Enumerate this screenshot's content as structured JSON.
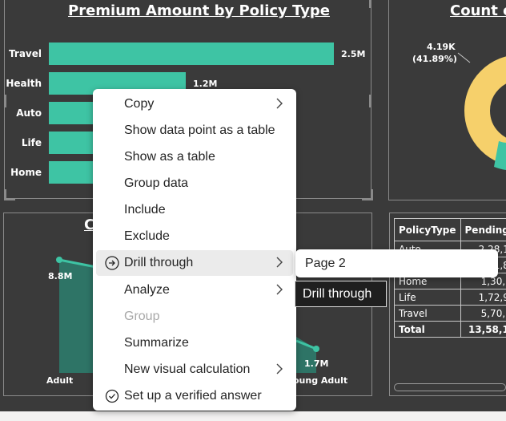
{
  "bar_visual": {
    "title": "Premium Amount by Policy Type",
    "chart_data": {
      "type": "bar",
      "orientation": "horizontal",
      "categories": [
        "Travel",
        "Health",
        "Auto",
        "Life",
        "Home"
      ],
      "values": [
        2.5,
        1.2,
        0.95,
        0.85,
        0.75
      ],
      "value_labels": [
        "2.5M",
        "1.2M",
        "",
        "",
        ""
      ],
      "unit": "M",
      "color": "#3ec4a4"
    }
  },
  "donut_visual": {
    "title": "Count o",
    "label_value": "4.19K",
    "label_pct": "(41.89%)",
    "colors": [
      "#f6d06b",
      "#3ec4a4"
    ]
  },
  "area_visual": {
    "title": "C",
    "chart_data": {
      "type": "area",
      "categories": [
        "Adult",
        "Young Adult"
      ],
      "labels": [
        "8.8M",
        "1.7M"
      ],
      "x_labels": [
        "Adult",
        "oung Adult"
      ],
      "color": "#3ec4a4"
    }
  },
  "matrix": {
    "headers": [
      "PolicyType",
      "Pending"
    ],
    "rows": [
      [
        "Auto",
        "2,28,1"
      ],
      [
        "",
        "1,8"
      ],
      [
        "Home",
        "1,30,("
      ],
      [
        "Life",
        "1,72,9"
      ],
      [
        "Travel",
        "5,70,("
      ]
    ],
    "total": [
      "Total",
      "13,58,1"
    ]
  },
  "context_menu": {
    "items": [
      {
        "label": "Copy",
        "submenu": true,
        "icon": "",
        "disabled": false
      },
      {
        "label": "Show data point as a table",
        "submenu": false,
        "icon": "",
        "disabled": false
      },
      {
        "label": "Show as a table",
        "submenu": false,
        "icon": "",
        "disabled": false
      },
      {
        "label": "Group data",
        "submenu": false,
        "icon": "",
        "disabled": false
      },
      {
        "label": "Include",
        "submenu": false,
        "icon": "",
        "disabled": false
      },
      {
        "label": "Exclude",
        "submenu": false,
        "icon": "",
        "disabled": false
      },
      {
        "label": "Drill through",
        "submenu": true,
        "icon": "drill-through-icon",
        "disabled": false
      },
      {
        "label": "Analyze",
        "submenu": true,
        "icon": "",
        "disabled": false
      },
      {
        "label": "Group",
        "submenu": false,
        "icon": "",
        "disabled": true
      },
      {
        "label": "Summarize",
        "submenu": false,
        "icon": "",
        "disabled": false
      },
      {
        "label": "New visual calculation",
        "submenu": true,
        "icon": "",
        "disabled": false
      },
      {
        "label": "Set up a verified answer",
        "submenu": false,
        "icon": "verified-answer-icon",
        "disabled": false
      }
    ]
  },
  "submenu": {
    "label": "Page 2"
  },
  "tooltip": {
    "label": "Drill through"
  },
  "colors": {
    "canvas": "#3a3a3a",
    "accent": "#3ec4a4",
    "donut": "#f6d06b"
  }
}
